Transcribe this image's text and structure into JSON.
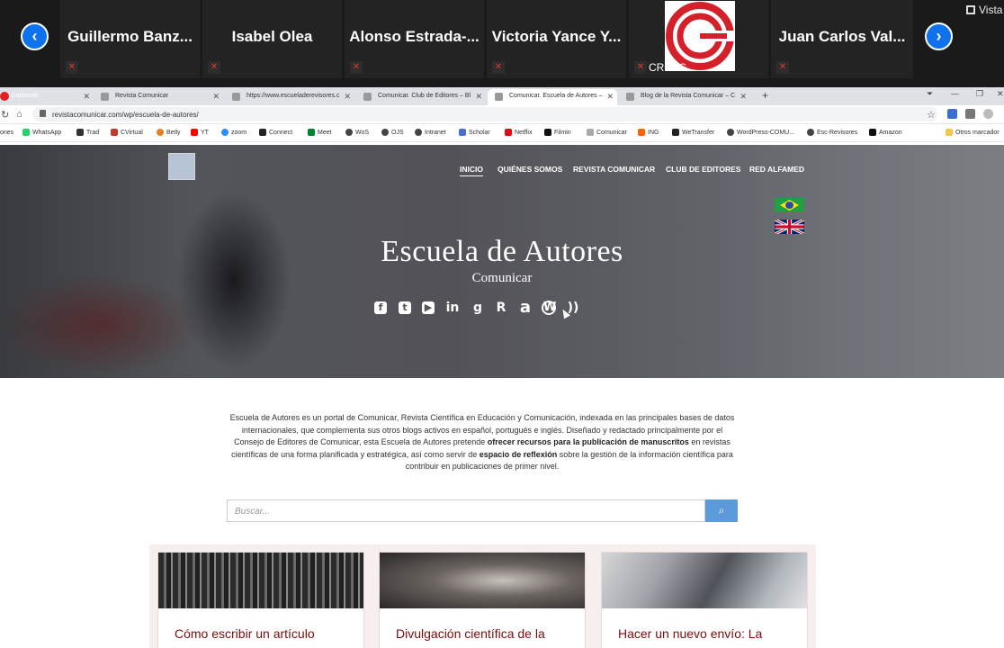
{
  "zoom": {
    "participants": [
      {
        "name": "Guillermo  Banz..."
      },
      {
        "name": "Isabel Olea"
      },
      {
        "name": "Alonso  Estrada-..."
      },
      {
        "name": "Victoria Yance Y..."
      },
      {
        "name": "CRECS"
      },
      {
        "name": "Juan Carlos Val..."
      }
    ],
    "view_label": "Vista",
    "accent": "#0e72ed"
  },
  "browser": {
    "recording_label": "Grabando",
    "tabs": [
      {
        "label": "Revista Comunicar"
      },
      {
        "label": "https://www.escueladerevisores.c"
      },
      {
        "label": "Comunicar. Club de Editores – Bl"
      },
      {
        "label": "Comunicar. Escuela de Autores –"
      },
      {
        "label": "Blog de la Revista Comunicar – C"
      }
    ],
    "url": "revistacomunicar.com/wp/escuela-de-autores/",
    "bookmarks": [
      "ones",
      "WhatsApp",
      "Trad",
      "CVirtual",
      "Betly",
      "YT",
      "zoom",
      "Connect",
      "Meet",
      "WoS",
      "OJS",
      "Intranet",
      "Scholar",
      "Netflix",
      "Filmin",
      "Comunicar",
      "ING",
      "WeTransfer",
      "WordPress-COMU...",
      "Esc-Revisores",
      "Amazon",
      "Otros marcador"
    ]
  },
  "site": {
    "nav": [
      "INICIO",
      "QUIÉNES SOMOS",
      "REVISTA COMUNICAR",
      "CLUB DE EDITORES",
      "RED ALFAMED"
    ],
    "title": "Escuela de Autores",
    "subtitle": "Comunicar",
    "social_icons": [
      "facebook-icon",
      "twitter-icon",
      "youtube-icon",
      "linkedin-icon",
      "google-scholar-icon",
      "researchgate-icon",
      "academia-icon",
      "wordpress-icon",
      "rss-icon"
    ],
    "intro": {
      "p1": "Escuela de Autores es un portal de Comunicar, Revista Científica en Educación y Comunicación, indexada en las principales bases de datos internacionales, que complementa sus otros blogs activos en español, portugués e inglés. Diseñado y redactado principalmente por el Consejo de Editores de Comunicar, esta Escuela de Autores pretende ",
      "b1": "ofrecer recursos para la publicación de manuscritos",
      "p2": " en revistas científicas de una forma planificada y estratégica, así como servir de ",
      "b2": "espacio de reflexión",
      "p3": " sobre la gestión de la información científica para contribuir en publicaciones de primer nivel."
    },
    "search_placeholder": "Buscar...",
    "cards": [
      {
        "title": "Cómo escribir un artículo"
      },
      {
        "title": "Divulgación científica de la"
      },
      {
        "title": "Hacer un nuevo envío: La"
      }
    ],
    "accent_color": "#7a0d0d",
    "search_button_color": "#5b9bd9"
  }
}
